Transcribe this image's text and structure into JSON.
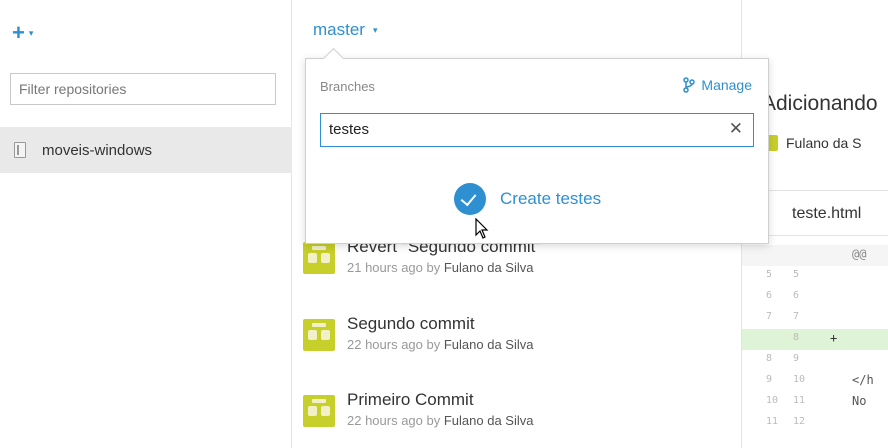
{
  "sidebar": {
    "add_caret": "▾",
    "filter_placeholder": "Filter repositories",
    "repos": [
      {
        "label": "moveis-windows"
      }
    ]
  },
  "branch_selector": {
    "current": "master",
    "caret": "▾"
  },
  "branch_popup": {
    "header": "Branches",
    "manage_label": "Manage",
    "search_value": "testes",
    "clear_icon": "✕",
    "create_label": "Create testes"
  },
  "commits": [
    {
      "title": "Revert \"Segundo commit\"",
      "time": "21 hours ago by",
      "author": "Fulano da Silva"
    },
    {
      "title": "Segundo commit",
      "time": "22 hours ago by",
      "author": "Fulano da Silva"
    },
    {
      "title": "Primeiro Commit",
      "time": "22 hours ago by",
      "author": "Fulano da Silva"
    }
  ],
  "detail": {
    "heading": "Adicionando",
    "author": "Fulano da S",
    "file": "teste.html",
    "diff": [
      {
        "ln1": "",
        "ln2": "",
        "code": "@@",
        "type": "hunk"
      },
      {
        "ln1": "5",
        "ln2": "5",
        "code": "",
        "type": "ctx"
      },
      {
        "ln1": "6",
        "ln2": "6",
        "code": "",
        "type": "ctx"
      },
      {
        "ln1": "7",
        "ln2": "7",
        "code": "",
        "type": "ctx"
      },
      {
        "ln1": "",
        "ln2": "8",
        "code": "",
        "type": "added",
        "sign": "+"
      },
      {
        "ln1": "8",
        "ln2": "9",
        "code": "",
        "type": "ctx"
      },
      {
        "ln1": "9",
        "ln2": "10",
        "code": "</h",
        "type": "ctx"
      },
      {
        "ln1": "10",
        "ln2": "11",
        "code": "No",
        "type": "ctx"
      },
      {
        "ln1": "11",
        "ln2": "12",
        "code": "",
        "type": "ctx"
      }
    ]
  },
  "colors": {
    "accent": "#2e8fd1",
    "avatar": "#c7cf2a",
    "added_line": "#dff3d6"
  }
}
